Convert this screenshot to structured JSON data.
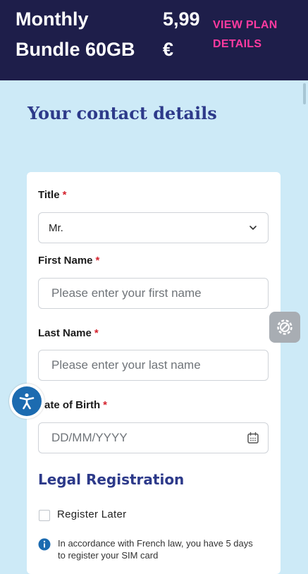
{
  "header": {
    "plan_name": "Monthly Bundle 60GB",
    "price": "5,99 €",
    "view_plan_link": "VIEW PLAN DETAILS"
  },
  "section_title": "Your contact details",
  "form": {
    "title_field": {
      "label": "Title",
      "required_mark": "*",
      "value": "Mr."
    },
    "first_name": {
      "label": "First Name",
      "required_mark": "*",
      "placeholder": "Please enter your first name"
    },
    "last_name": {
      "label": "Last Name",
      "required_mark": "*",
      "placeholder": "Please enter your last name"
    },
    "date_of_birth": {
      "label": "ate of Birth",
      "required_mark": "*",
      "placeholder": "DD/MM/YYYY"
    }
  },
  "legal": {
    "title": "Legal Registration",
    "register_later_label": "Register Later",
    "info_text": "In accordance with French law, you have 5 days to register your SIM card"
  },
  "icons": {
    "settings": "settings-gear-icon",
    "accessibility": "accessibility-icon",
    "calendar": "calendar-icon",
    "chevron": "chevron-down-icon",
    "info": "info-icon"
  },
  "colors": {
    "header_bg": "#1e1e4a",
    "accent_pink": "#ff3aa0",
    "page_bg": "#cdeaf7",
    "title_blue": "#2d3a8a",
    "required_red": "#d4232e",
    "info_blue": "#1c6bb0"
  }
}
